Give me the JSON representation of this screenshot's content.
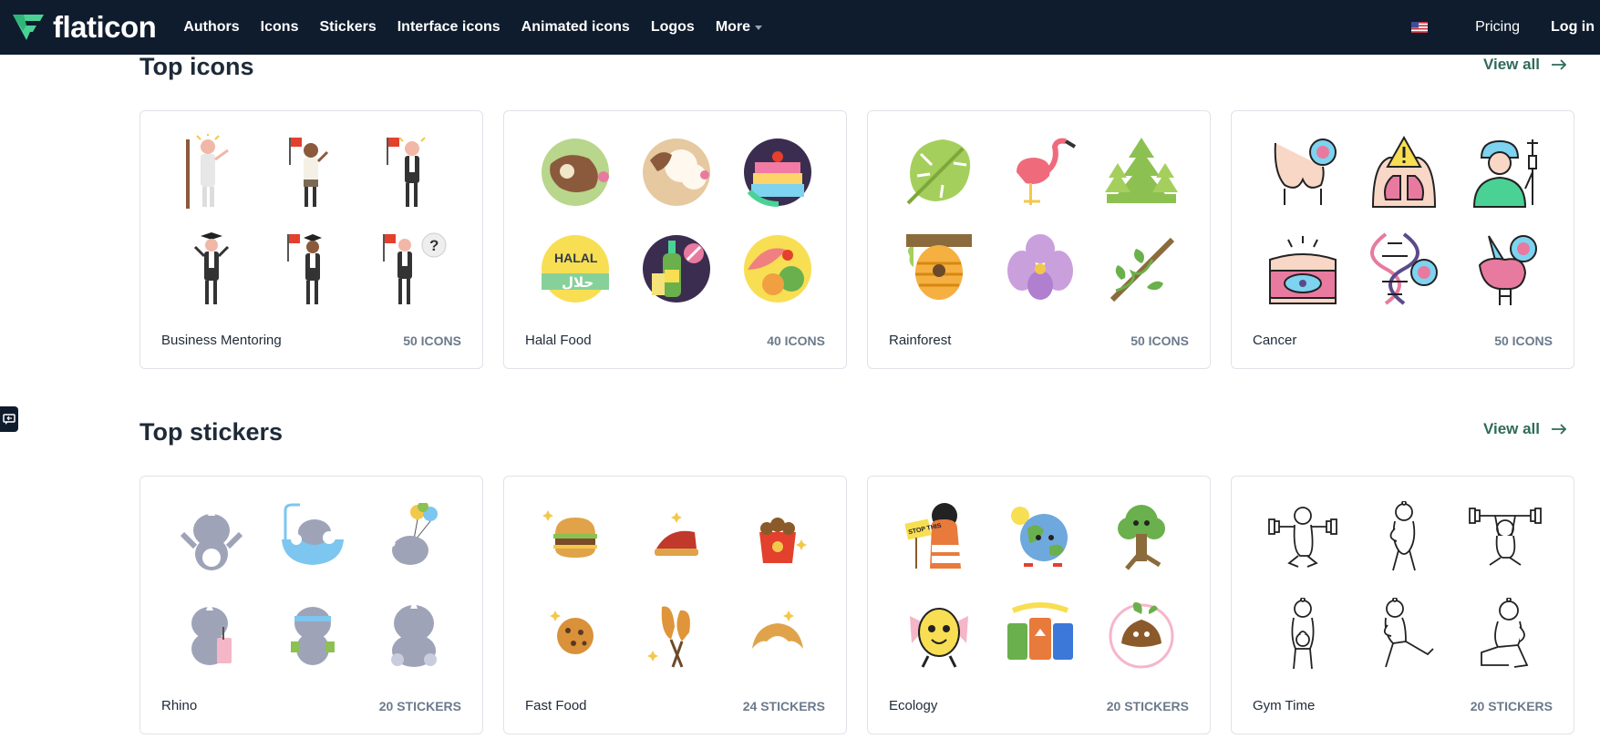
{
  "brand": {
    "name": "flaticon",
    "accent": "#4ad295",
    "nav_bg": "#0f1c2e"
  },
  "nav": [
    {
      "label": "Authors"
    },
    {
      "label": "Icons"
    },
    {
      "label": "Stickers"
    },
    {
      "label": "Interface icons"
    },
    {
      "label": "Animated icons"
    },
    {
      "label": "Logos"
    },
    {
      "label": "More"
    }
  ],
  "header_right": {
    "flag_icon": "us-flag-icon",
    "pricing": "Pricing",
    "login": "Log in"
  },
  "sections": {
    "icons": {
      "title": "Top icons",
      "view_all": "View all",
      "cards": [
        {
          "name": "Business Mentoring",
          "count": "50 ICONS"
        },
        {
          "name": "Halal Food",
          "count": "40 ICONS"
        },
        {
          "name": "Rainforest",
          "count": "50 ICONS"
        },
        {
          "name": "Cancer",
          "count": "50 ICONS"
        }
      ]
    },
    "stickers": {
      "title": "Top stickers",
      "view_all": "View all",
      "cards": [
        {
          "name": "Rhino",
          "count": "20 STICKERS"
        },
        {
          "name": "Fast Food",
          "count": "24 STICKERS"
        },
        {
          "name": "Ecology",
          "count": "20 STICKERS"
        },
        {
          "name": "Gym Time",
          "count": "20 STICKERS"
        }
      ]
    }
  },
  "thumb_labels": {
    "halal_badge": "HALAL",
    "halal_arabic": "حلال",
    "question_mark": "?",
    "stop_sign": "STOP THIS"
  }
}
